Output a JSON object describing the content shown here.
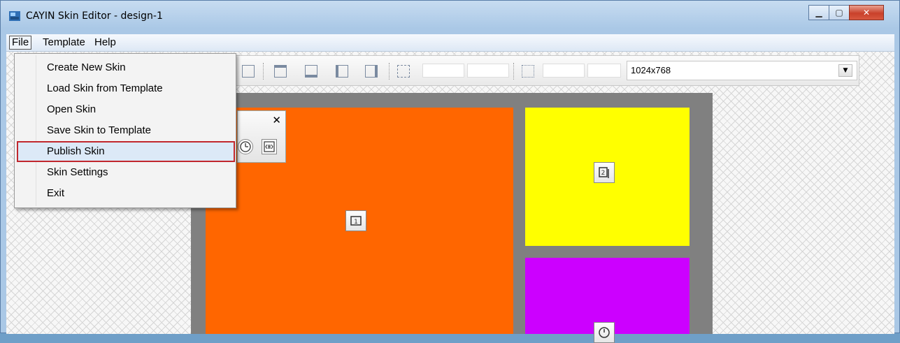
{
  "window": {
    "title": "CAYIN Skin Editor - design-1"
  },
  "menubar": {
    "file": "File",
    "template": "Template",
    "help": "Help"
  },
  "file_menu": {
    "items": [
      "Create New Skin",
      "Load Skin from Template",
      "Open Skin",
      "Save Skin to Template",
      "Publish Skin",
      "Skin Settings",
      "Exit"
    ],
    "highlighted": "Publish Skin"
  },
  "toolbar": {
    "resolution": "1024x768"
  },
  "zones": [
    {
      "color": "#ff6600",
      "icon": "video-zone-icon",
      "label": "1"
    },
    {
      "color": "#ffff00",
      "icon": "image-zone-icon",
      "label": "2"
    },
    {
      "color": "#cc00ff",
      "icon": "clock-zone-icon",
      "label": ""
    }
  ],
  "palette": {
    "close": "✕"
  }
}
